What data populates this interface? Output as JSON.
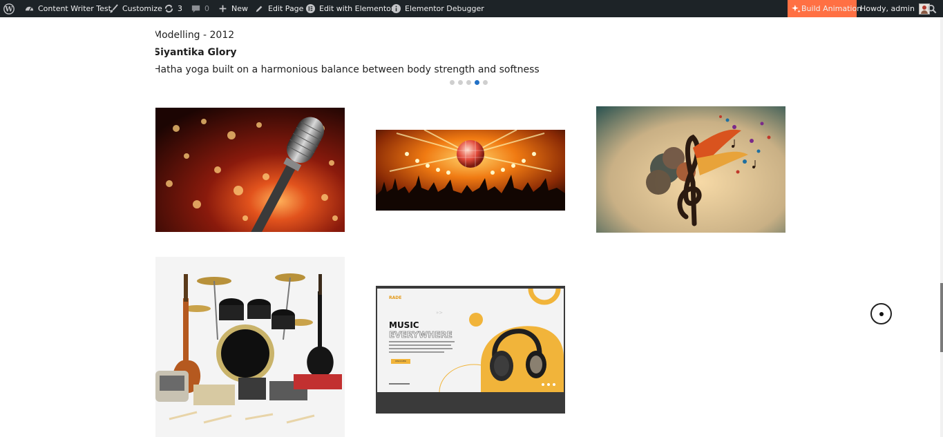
{
  "adminbar": {
    "site_name": "Content Writer Test",
    "customize": "Customize",
    "updates_count": "3",
    "comments_count": "0",
    "new": "New",
    "edit_page": "Edit Page",
    "edit_elementor": "Edit with Elementor",
    "elementor_debugger": "Elementor Debugger",
    "build_animation": "Build Animation",
    "howdy": "Howdy, admin",
    "build_animation_color": "#ff7043"
  },
  "testimonial": {
    "role": "Modelling - 2012",
    "name": "Siyantika Glory",
    "quote": "Hatha yoga built on a harmonious balance between body strength and softness",
    "slides": 5,
    "active_slide": 4
  },
  "gallery": {
    "items": [
      {
        "name": "microphone-image"
      },
      {
        "name": "disco-ball-crowd-image"
      },
      {
        "name": "music-tree-image"
      },
      {
        "name": "instruments-image"
      },
      {
        "name": "music-banner-image",
        "brand": "RADE",
        "heading_1": "MUSIC",
        "heading_2": "EVERYWHERE",
        "button": "DISCOVER"
      }
    ]
  }
}
